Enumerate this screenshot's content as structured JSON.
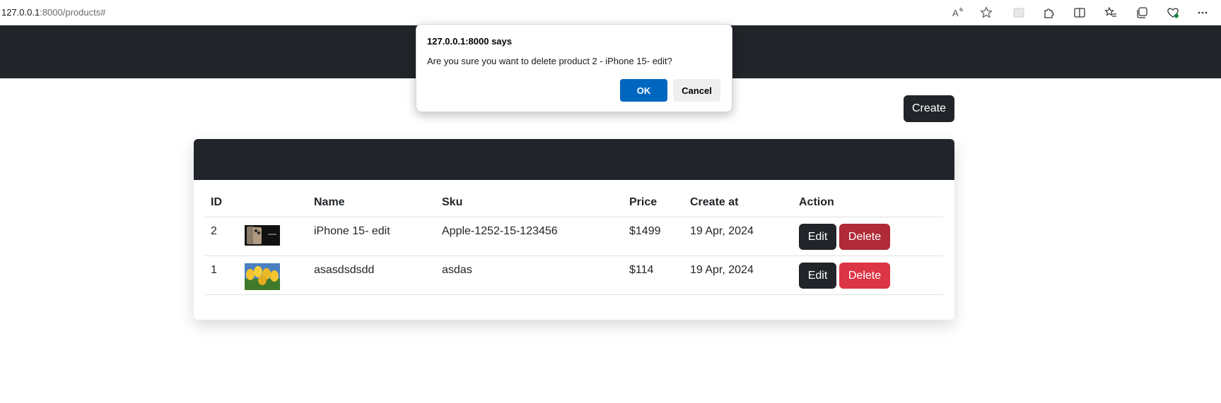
{
  "browser": {
    "url_host": "127.0.0.1",
    "url_rest": ":8000/products#",
    "icons": [
      "read-aloud-icon",
      "favorite-star-icon",
      "extension-placeholder-icon",
      "extensions-icon",
      "split-screen-icon",
      "favorites-icon",
      "collections-icon",
      "browser-essentials-icon",
      "more-icon"
    ]
  },
  "toolbar": {
    "create_label": "Create"
  },
  "table": {
    "headers": [
      "ID",
      "",
      "Name",
      "Sku",
      "Price",
      "Create at",
      "Action"
    ],
    "rows": [
      {
        "id": "2",
        "image": "phone-thumbnail",
        "name": "iPhone 15- edit",
        "sku": "Apple-1252-15-123456",
        "price": "$1499",
        "created": "19 Apr, 2024",
        "edit_label": "Edit",
        "delete_label": "Delete"
      },
      {
        "id": "1",
        "image": "tulips-thumbnail",
        "name": "asasdsdsdd",
        "sku": "asdas",
        "price": "$114",
        "created": "19 Apr, 2024",
        "edit_label": "Edit",
        "delete_label": "Delete"
      }
    ]
  },
  "dialog": {
    "title": "127.0.0.1:8000 says",
    "message": "Are you sure you want to delete product 2 - iPhone 15- edit?",
    "ok_label": "OK",
    "cancel_label": "Cancel"
  },
  "colors": {
    "dark": "#212529",
    "danger": "#dc3545",
    "dialog_primary": "#0067c0"
  }
}
